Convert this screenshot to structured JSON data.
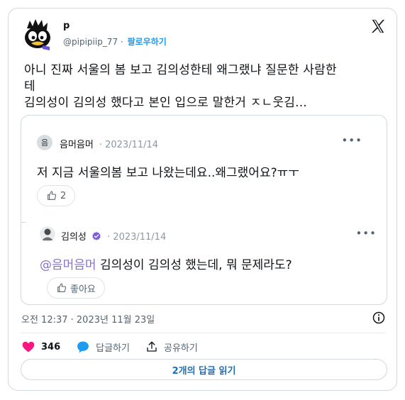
{
  "author": {
    "name": "p",
    "handle": "@pipipiip_77",
    "separator": "·",
    "follow_label": "팔로우하기"
  },
  "tweet": {
    "lines": [
      "아니 진짜 서울의 봄 보고 김의성한테 왜그랬냐 질문한 사람한",
      "테",
      "김의성이 김의성 했다고 본인 입으로 말한거 ㅈㄴ웃김..."
    ]
  },
  "quote": {
    "first": {
      "avatar_char": "음",
      "name": "음머음머",
      "date": "· 2023/11/14",
      "text": "저 지금 서울의봄 보고 나왔는데요..왜그랬어요?ㅠㅜ",
      "like_count": "2"
    },
    "reply": {
      "name": "김의성",
      "date": "· 2023/11/14",
      "mention": "@음머음머",
      "text": " 김의성이 김의성 했는데, 뭐 문제라도?",
      "like_label": "좋아요"
    }
  },
  "timestamp": "오전 12:37 · 2023년 11월 23일",
  "actions": {
    "like_count": "346",
    "reply_label": "답글하기",
    "share_label": "공유하기"
  },
  "replies_button": "2개의 답글 읽기",
  "colors": {
    "accent": "#1d9bf0",
    "mention": "#8a6fd1",
    "like": "#f91880",
    "verified": "#7c5cd6"
  }
}
